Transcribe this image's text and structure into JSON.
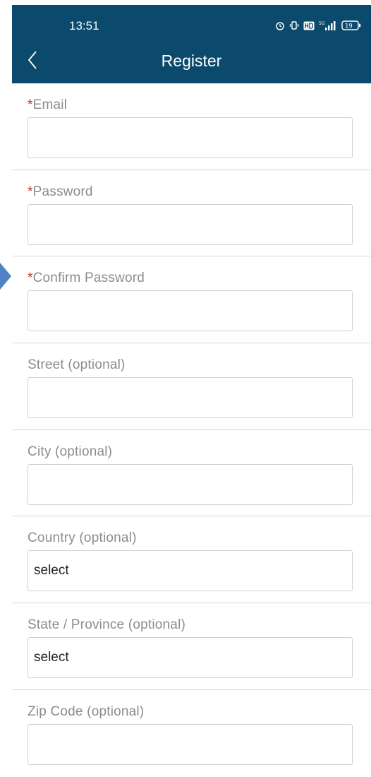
{
  "status_bar": {
    "time": "13:51",
    "battery": "19",
    "network": "5G"
  },
  "header": {
    "title": "Register",
    "back_icon": "chevron-left-icon"
  },
  "colors": {
    "header_bg": "#0b4a6c",
    "required_asterisk": "#c0392b",
    "label_text": "#8c8c8c",
    "input_border": "#cfcfcf",
    "divider": "#d9d9d9"
  },
  "form": {
    "fields": [
      {
        "label": "Email",
        "required": true,
        "type": "text",
        "value": ""
      },
      {
        "label": "Password",
        "required": true,
        "type": "password",
        "value": ""
      },
      {
        "label": "Confirm Password",
        "required": true,
        "type": "password",
        "value": ""
      },
      {
        "label": "Street (optional)",
        "required": false,
        "type": "text",
        "value": ""
      },
      {
        "label": "City (optional)",
        "required": false,
        "type": "text",
        "value": ""
      },
      {
        "label": "Country (optional)",
        "required": false,
        "type": "select",
        "value": "select"
      },
      {
        "label": "State / Province (optional)",
        "required": false,
        "type": "select",
        "value": "select"
      },
      {
        "label": "Zip Code (optional)",
        "required": false,
        "type": "text",
        "value": ""
      }
    ]
  }
}
